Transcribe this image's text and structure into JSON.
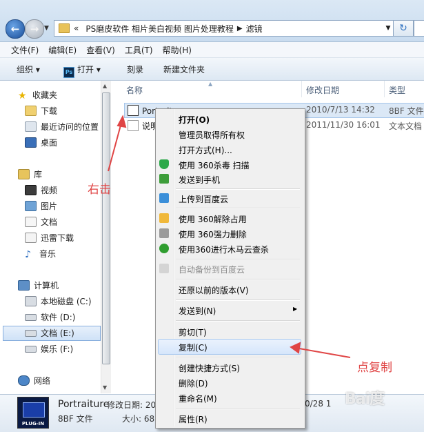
{
  "address": {
    "prefix": "«",
    "path": [
      "PS磨皮软件 相片美白视频 图片处理教程",
      "滤镜"
    ]
  },
  "menubar": [
    "文件(F)",
    "编辑(E)",
    "查看(V)",
    "工具(T)",
    "帮助(H)"
  ],
  "toolbar": {
    "organize": "组织 ▾",
    "open": "打开 ▾",
    "open_icon": "Ps",
    "burn": "刻录",
    "new_folder": "新建文件夹"
  },
  "nav": {
    "favorites": "收藏夹",
    "downloads": "下载",
    "recent": "最近访问的位置",
    "desktop": "桌面",
    "libraries": "库",
    "videos": "视频",
    "pictures": "图片",
    "documents": "文档",
    "thunder": "迅雷下载",
    "music": "音乐",
    "computer": "计算机",
    "drive_c": "本地磁盘 (C:)",
    "drive_d": "软件 (D:)",
    "drive_e": "文档 (E:)",
    "drive_f": "娱乐 (F:)",
    "network": "网络"
  },
  "columns": {
    "name": "名称",
    "date": "修改日期",
    "type": "类型"
  },
  "files": [
    {
      "name": "Portrait",
      "date": "2010/7/13 14:32",
      "type": "8BF 文件"
    },
    {
      "name": "说明",
      "date": "2011/11/30 16:01",
      "type": "文本文档"
    }
  ],
  "details": {
    "name": "Portraiture",
    "type": "8BF 文件",
    "date_label": "修改日期: 20",
    "size_label": "大小: 68",
    "date_tail": "0/28 1",
    "icon_text": "PLUG-IN"
  },
  "context_menu": {
    "open": "打开(O)",
    "admin": "管理员取得所有权",
    "open_with": "打开方式(H)...",
    "scan360": "使用 360杀毒 扫描",
    "send_phone": "发送到手机",
    "baidu_upload": "上传到百度云",
    "unlock360": "使用 360解除占用",
    "delete360": "使用 360强力删除",
    "trojan360": "使用360进行木马云查杀",
    "auto_backup": "自动备份到百度云",
    "restore": "还原以前的版本(V)",
    "send_to": "发送到(N)",
    "cut": "剪切(T)",
    "copy": "复制(C)",
    "shortcut": "创建快捷方式(S)",
    "delete": "删除(D)",
    "rename": "重命名(M)",
    "properties": "属性(R)"
  },
  "annotations": {
    "right_click": "右击",
    "click_copy": "点复制"
  },
  "watermark": "Bai度",
  "colors": {
    "annotation": "#e04545",
    "selection": "#dbe8f6"
  }
}
